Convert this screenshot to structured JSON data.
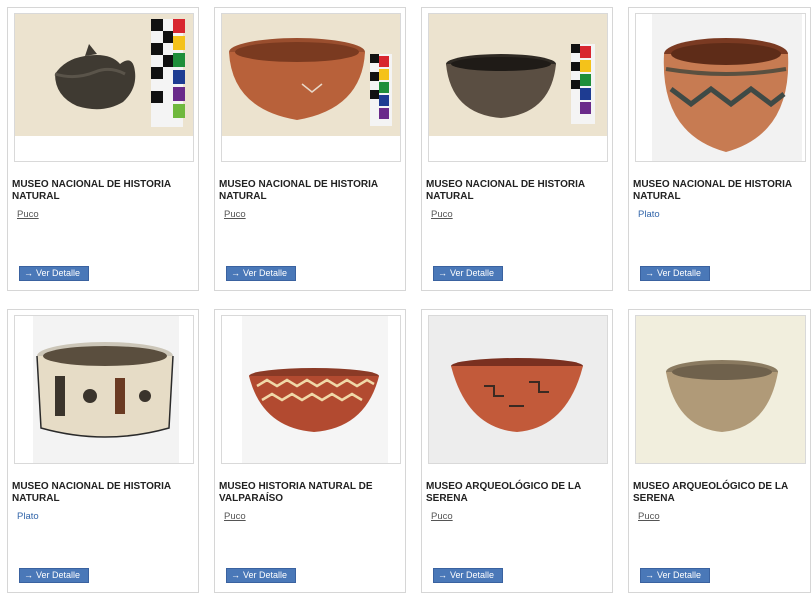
{
  "items": [
    {
      "museum": "MUSEO NACIONAL DE HISTORIA NATURAL",
      "type": "Puco",
      "button_label": "Ver Detalle",
      "image": "broken-dark-bowl-with-color-scale"
    },
    {
      "museum": "MUSEO NACIONAL DE HISTORIA NATURAL",
      "type": "Puco",
      "button_label": "Ver Detalle",
      "image": "red-clay-bowl-with-color-scale"
    },
    {
      "museum": "MUSEO NACIONAL DE HISTORIA NATURAL",
      "type": "Puco",
      "button_label": "Ver Detalle",
      "image": "dark-clay-bowl-with-color-scale"
    },
    {
      "museum": "MUSEO NACIONAL DE HISTORIA NATURAL",
      "type": "Plato",
      "button_label": "Ver Detalle",
      "image": "painted-deep-bowl"
    },
    {
      "museum": "MUSEO NACIONAL DE HISTORIA NATURAL",
      "type": "Plato",
      "button_label": "Ver Detalle",
      "image": "cream-painted-bowl"
    },
    {
      "museum": "MUSEO HISTORIA NATURAL DE VALPARAÍSO",
      "type": "Puco",
      "button_label": "Ver Detalle",
      "image": "wave-pattern-bowl"
    },
    {
      "museum": "MUSEO ARQUEOLÓGICO DE LA SERENA",
      "type": "Puco",
      "button_label": "Ver Detalle",
      "image": "red-geometric-bowl"
    },
    {
      "museum": "MUSEO ARQUEOLÓGICO DE LA SERENA",
      "type": "Puco",
      "button_label": "Ver Detalle",
      "image": "plain-tan-bowl"
    }
  ],
  "colors": {
    "button_bg": "#4a78b8",
    "link_blue": "#3366aa",
    "card_border": "#d6d6d6"
  },
  "icons": {
    "button_icon": "arrow-right-icon"
  }
}
